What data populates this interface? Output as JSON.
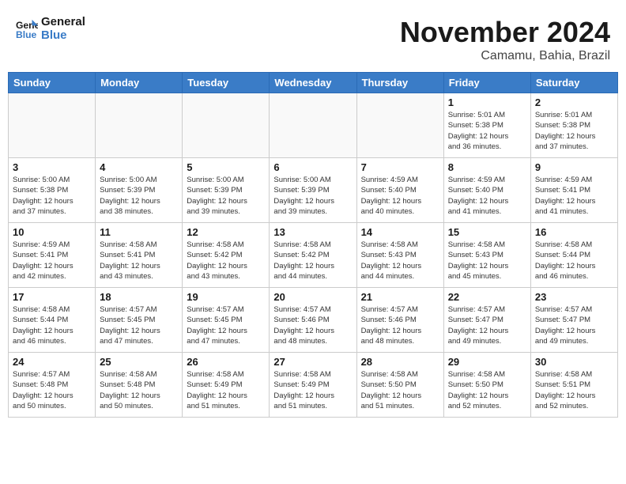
{
  "header": {
    "logo_line1": "General",
    "logo_line2": "Blue",
    "month": "November 2024",
    "location": "Camamu, Bahia, Brazil"
  },
  "weekdays": [
    "Sunday",
    "Monday",
    "Tuesday",
    "Wednesday",
    "Thursday",
    "Friday",
    "Saturday"
  ],
  "weeks": [
    [
      {
        "day": "",
        "info": ""
      },
      {
        "day": "",
        "info": ""
      },
      {
        "day": "",
        "info": ""
      },
      {
        "day": "",
        "info": ""
      },
      {
        "day": "",
        "info": ""
      },
      {
        "day": "1",
        "info": "Sunrise: 5:01 AM\nSunset: 5:38 PM\nDaylight: 12 hours\nand 36 minutes."
      },
      {
        "day": "2",
        "info": "Sunrise: 5:01 AM\nSunset: 5:38 PM\nDaylight: 12 hours\nand 37 minutes."
      }
    ],
    [
      {
        "day": "3",
        "info": "Sunrise: 5:00 AM\nSunset: 5:38 PM\nDaylight: 12 hours\nand 37 minutes."
      },
      {
        "day": "4",
        "info": "Sunrise: 5:00 AM\nSunset: 5:39 PM\nDaylight: 12 hours\nand 38 minutes."
      },
      {
        "day": "5",
        "info": "Sunrise: 5:00 AM\nSunset: 5:39 PM\nDaylight: 12 hours\nand 39 minutes."
      },
      {
        "day": "6",
        "info": "Sunrise: 5:00 AM\nSunset: 5:39 PM\nDaylight: 12 hours\nand 39 minutes."
      },
      {
        "day": "7",
        "info": "Sunrise: 4:59 AM\nSunset: 5:40 PM\nDaylight: 12 hours\nand 40 minutes."
      },
      {
        "day": "8",
        "info": "Sunrise: 4:59 AM\nSunset: 5:40 PM\nDaylight: 12 hours\nand 41 minutes."
      },
      {
        "day": "9",
        "info": "Sunrise: 4:59 AM\nSunset: 5:41 PM\nDaylight: 12 hours\nand 41 minutes."
      }
    ],
    [
      {
        "day": "10",
        "info": "Sunrise: 4:59 AM\nSunset: 5:41 PM\nDaylight: 12 hours\nand 42 minutes."
      },
      {
        "day": "11",
        "info": "Sunrise: 4:58 AM\nSunset: 5:41 PM\nDaylight: 12 hours\nand 43 minutes."
      },
      {
        "day": "12",
        "info": "Sunrise: 4:58 AM\nSunset: 5:42 PM\nDaylight: 12 hours\nand 43 minutes."
      },
      {
        "day": "13",
        "info": "Sunrise: 4:58 AM\nSunset: 5:42 PM\nDaylight: 12 hours\nand 44 minutes."
      },
      {
        "day": "14",
        "info": "Sunrise: 4:58 AM\nSunset: 5:43 PM\nDaylight: 12 hours\nand 44 minutes."
      },
      {
        "day": "15",
        "info": "Sunrise: 4:58 AM\nSunset: 5:43 PM\nDaylight: 12 hours\nand 45 minutes."
      },
      {
        "day": "16",
        "info": "Sunrise: 4:58 AM\nSunset: 5:44 PM\nDaylight: 12 hours\nand 46 minutes."
      }
    ],
    [
      {
        "day": "17",
        "info": "Sunrise: 4:58 AM\nSunset: 5:44 PM\nDaylight: 12 hours\nand 46 minutes."
      },
      {
        "day": "18",
        "info": "Sunrise: 4:57 AM\nSunset: 5:45 PM\nDaylight: 12 hours\nand 47 minutes."
      },
      {
        "day": "19",
        "info": "Sunrise: 4:57 AM\nSunset: 5:45 PM\nDaylight: 12 hours\nand 47 minutes."
      },
      {
        "day": "20",
        "info": "Sunrise: 4:57 AM\nSunset: 5:46 PM\nDaylight: 12 hours\nand 48 minutes."
      },
      {
        "day": "21",
        "info": "Sunrise: 4:57 AM\nSunset: 5:46 PM\nDaylight: 12 hours\nand 48 minutes."
      },
      {
        "day": "22",
        "info": "Sunrise: 4:57 AM\nSunset: 5:47 PM\nDaylight: 12 hours\nand 49 minutes."
      },
      {
        "day": "23",
        "info": "Sunrise: 4:57 AM\nSunset: 5:47 PM\nDaylight: 12 hours\nand 49 minutes."
      }
    ],
    [
      {
        "day": "24",
        "info": "Sunrise: 4:57 AM\nSunset: 5:48 PM\nDaylight: 12 hours\nand 50 minutes."
      },
      {
        "day": "25",
        "info": "Sunrise: 4:58 AM\nSunset: 5:48 PM\nDaylight: 12 hours\nand 50 minutes."
      },
      {
        "day": "26",
        "info": "Sunrise: 4:58 AM\nSunset: 5:49 PM\nDaylight: 12 hours\nand 51 minutes."
      },
      {
        "day": "27",
        "info": "Sunrise: 4:58 AM\nSunset: 5:49 PM\nDaylight: 12 hours\nand 51 minutes."
      },
      {
        "day": "28",
        "info": "Sunrise: 4:58 AM\nSunset: 5:50 PM\nDaylight: 12 hours\nand 51 minutes."
      },
      {
        "day": "29",
        "info": "Sunrise: 4:58 AM\nSunset: 5:50 PM\nDaylight: 12 hours\nand 52 minutes."
      },
      {
        "day": "30",
        "info": "Sunrise: 4:58 AM\nSunset: 5:51 PM\nDaylight: 12 hours\nand 52 minutes."
      }
    ]
  ]
}
